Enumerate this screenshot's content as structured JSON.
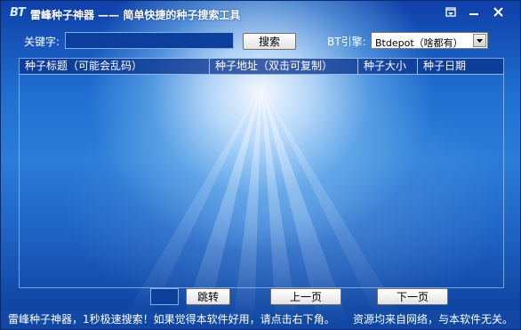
{
  "window": {
    "app_icon_text": "BT",
    "title": "雷峰种子神器 —— 简单快捷的种子搜索工具",
    "buttons": [
      "restore-icon",
      "minimize-icon",
      "close-icon"
    ]
  },
  "search": {
    "keyword_label": "关键字:",
    "keyword_value": "",
    "search_button": "搜索",
    "engine_label": "BT引擎:",
    "engine_selected": "Btdepot（啥都有）"
  },
  "table": {
    "columns": [
      "种子标题（可能会乱码）",
      "种子地址（双击可复制）",
      "种子大小",
      "种子日期"
    ],
    "rows": []
  },
  "pagination": {
    "page_value": "",
    "jump_button": "跳转",
    "prev_button": "上一页",
    "next_button": "下一页"
  },
  "status": {
    "left": "雷峰种子神器，1秒极速搜索！如果觉得本软件好用，请点击右下角。",
    "right": "资源均来自网络，与本软件无关。"
  }
}
